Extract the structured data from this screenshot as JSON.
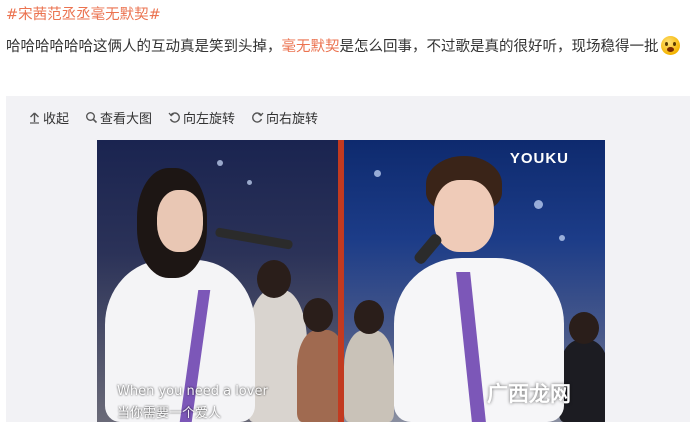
{
  "post": {
    "hashtag": "#宋茜范丞丞毫无默契#",
    "text_before": "哈哈哈哈哈哈这俩人的互动真是笑到头掉，",
    "mention": "毫无默契",
    "text_after": "是怎么回事，不过歌是真的很好听，现场稳得一批",
    "emoji": "scream-emoji"
  },
  "toolbar": {
    "collapse": "收起",
    "view_large": "查看大图",
    "rotate_left": "向左旋转",
    "rotate_right": "向右旋转"
  },
  "image": {
    "logo": "YOUKU",
    "subtitle_en": "When you need a lover",
    "subtitle_zh": "当你需要一个爱人",
    "watermark": "广西龙网",
    "divider_color": "#c23a20"
  }
}
